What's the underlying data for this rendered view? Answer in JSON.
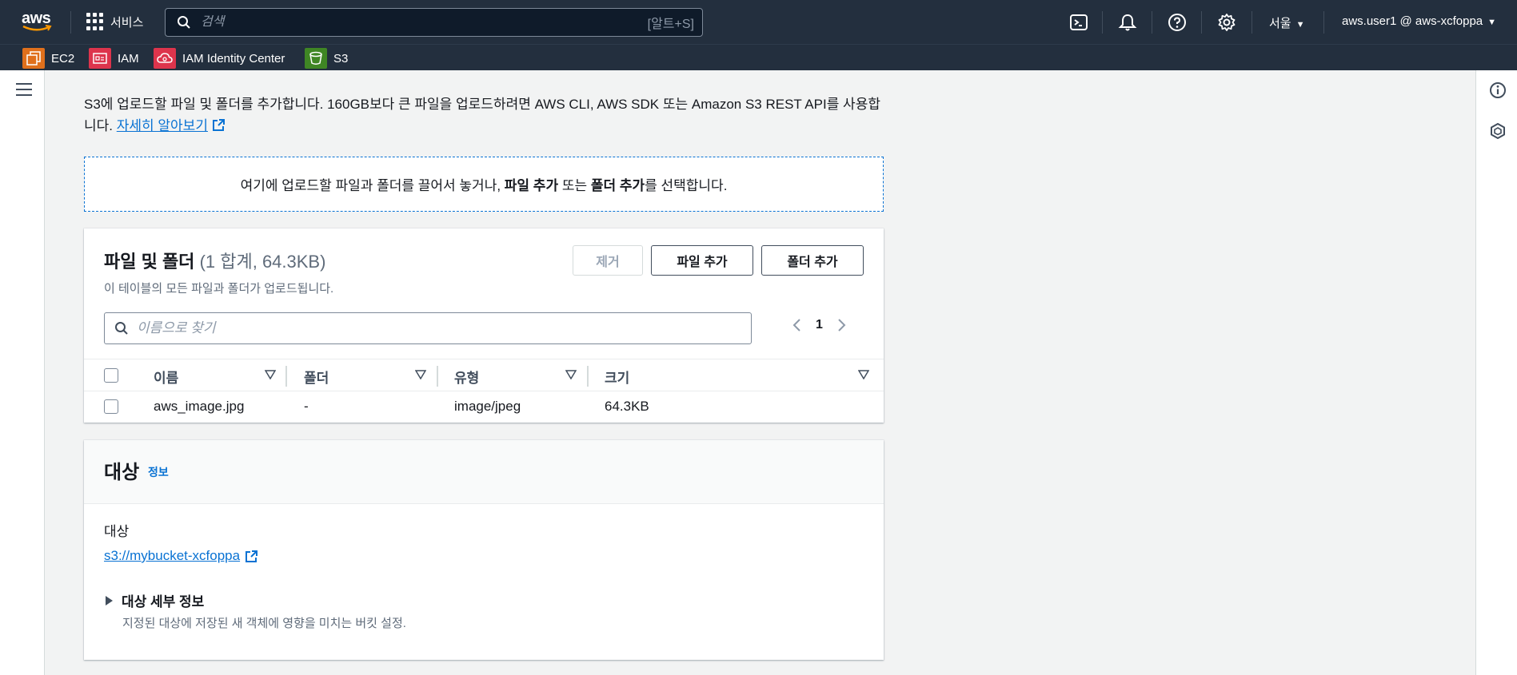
{
  "topnav": {
    "logo_text": "aws",
    "services_label": "서비스",
    "search_placeholder": "검색",
    "search_shortcut": "[알트+S]",
    "region": "서울",
    "account": "aws.user1 @ aws-xcfoppa"
  },
  "favorites": [
    {
      "label": "EC2",
      "color": "#e0701c"
    },
    {
      "label": "IAM",
      "color": "#dd344c"
    },
    {
      "label": "IAM Identity Center",
      "color": "#dd344c"
    },
    {
      "label": "S3",
      "color": "#3f8624"
    }
  ],
  "intro": {
    "text": "S3에 업로드할 파일 및 폴더를 추가합니다. 160GB보다 큰 파일을 업로드하려면 AWS CLI, AWS SDK 또는 Amazon S3 REST API를 사용합니다.",
    "link": "자세히 알아보기"
  },
  "dropzone": {
    "prefix": "여기에 업로드할 파일과 폴더를 끌어서 놓거나, ",
    "add_files": "파일 추가",
    "middle": " 또는 ",
    "add_folder": "폴더 추가",
    "suffix": "를 선택합니다."
  },
  "files": {
    "title": "파일 및 폴더",
    "count": "(1 합계, 64.3KB)",
    "description": "이 테이블의 모든 파일과 폴더가 업로드됩니다.",
    "remove_label": "제거",
    "add_files_label": "파일 추가",
    "add_folder_label": "폴더 추가",
    "search_placeholder": "이름으로 찾기",
    "page": "1",
    "columns": [
      "이름",
      "폴더",
      "유형",
      "크기"
    ],
    "rows": [
      {
        "name": "aws_image.jpg",
        "folder": "-",
        "type": "image/jpeg",
        "size": "64.3KB"
      }
    ]
  },
  "destination": {
    "title": "대상",
    "info": "정보",
    "label": "대상",
    "uri": "s3://mybucket-xcfoppa",
    "details_title": "대상 세부 정보",
    "details_desc": "지정된 대상에 저장된 새 객체에 영향을 미치는 버킷 설정."
  },
  "colors": {
    "nav_bg": "#232f3e",
    "link": "#0972d3",
    "page_bg": "#f2f3f3"
  }
}
